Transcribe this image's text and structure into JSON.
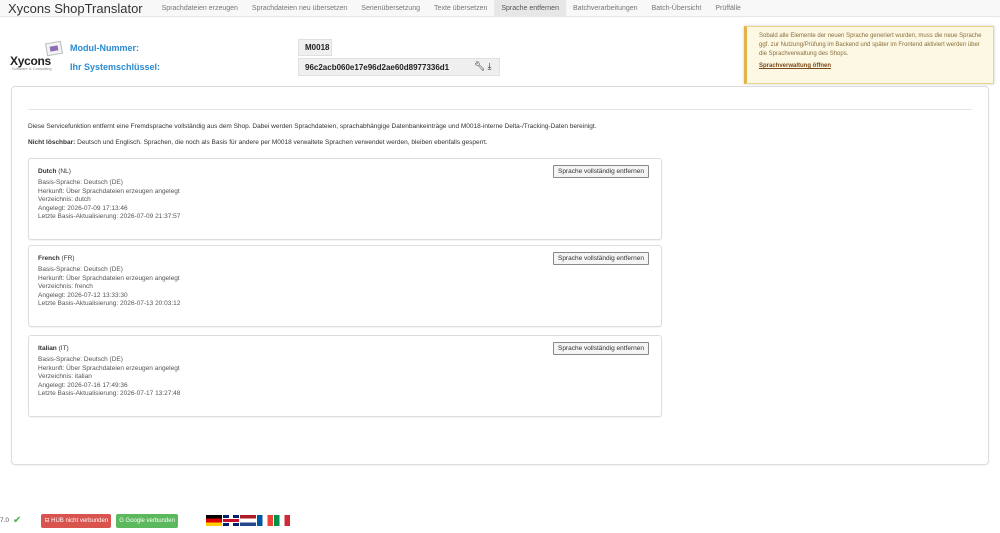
{
  "nav": {
    "brand": "Xycons ShopTranslator",
    "items": [
      {
        "label": "Sprachdateien erzeugen"
      },
      {
        "label": "Sprachdateien neu übersetzen"
      },
      {
        "label": "Serienübersetzung"
      },
      {
        "label": "Texte übersetzen"
      },
      {
        "label": "Sprache entfernen"
      },
      {
        "label": "Batchverarbeitungen"
      },
      {
        "label": "Batch-Übersicht"
      },
      {
        "label": "Prüffälle"
      }
    ],
    "active_item": "Sprache entfernen"
  },
  "module": {
    "logo_text": "Xycons",
    "logo_sub": "Software & Consulting",
    "module_label": "Modul-Nummer:",
    "module_value": "M0018",
    "key_label": "Ihr Systemschlüssel:",
    "key_value": "96c2acb060e17e96d2ae60d8977336d1",
    "key_icons": [
      "wrench-icon",
      "download-icon"
    ]
  },
  "notice": {
    "text": "Sobald alle Elemente der neuen Sprache generiert wurden, muss die neue Sprache ggf. zur Nutzung/Prüfung im Backend und später im Frontend aktiviert werden über die Sprachverwaltung des Shops.",
    "link": "Sprachverwaltung öffnen"
  },
  "panel": {
    "intro": "Diese Servicefunktion entfernt eine Fremdsprache vollständig aus dem Shop. Dabei werden Sprachdateien, sprachabhängige Datenbankeinträge und M0018-interne Delta-/Tracking-Daten bereinigt.",
    "protect_label": "Nicht löschbar:",
    "protect_text": " Deutsch und Englisch. Sprachen, die noch als Basis für andere per M0018 verwaltete Sprachen verwendet werden, bleiben ebenfalls gesperrt.",
    "button_label": "Sprache vollständig entfernen",
    "languages": [
      {
        "name": "Dutch",
        "code": "(NL)",
        "basis": "Basis-Sprache: Deutsch (DE)",
        "origin": "Herkunft: Über Sprachdateien erzeugen angelegt",
        "dir": "Verzeichnis: dutch",
        "created": "Angelegt: 2026-07-09 17:13:46",
        "updated": "Letzte Basis-Aktualisierung: 2026-07-09 21:37:57"
      },
      {
        "name": "French",
        "code": "(FR)",
        "basis": "Basis-Sprache: Deutsch (DE)",
        "origin": "Herkunft: Über Sprachdateien erzeugen angelegt",
        "dir": "Verzeichnis: french",
        "created": "Angelegt: 2026-07-12 13:33:30",
        "updated": "Letzte Basis-Aktualisierung: 2026-07-13 20:03:12"
      },
      {
        "name": "Italian",
        "code": "(IT)",
        "basis": "Basis-Sprache: Deutsch (DE)",
        "origin": "Herkunft: Über Sprachdateien erzeugen angelegt",
        "dir": "Verzeichnis: italian",
        "created": "Angelegt: 2026-07-16 17:49:36",
        "updated": "Letzte Basis-Aktualisierung: 2026-07-17 13:27:48"
      }
    ]
  },
  "footer": {
    "version": "7.0",
    "hub_badge": "HUB nicht verbunden",
    "google_badge": "Google verbunden",
    "flags": [
      "de",
      "gb",
      "nl",
      "fr",
      "it"
    ],
    "colors": {
      "ok": "#4aae4a",
      "danger": "#d9534f",
      "success": "#5cb85c",
      "link": "#2a8bd0"
    }
  }
}
